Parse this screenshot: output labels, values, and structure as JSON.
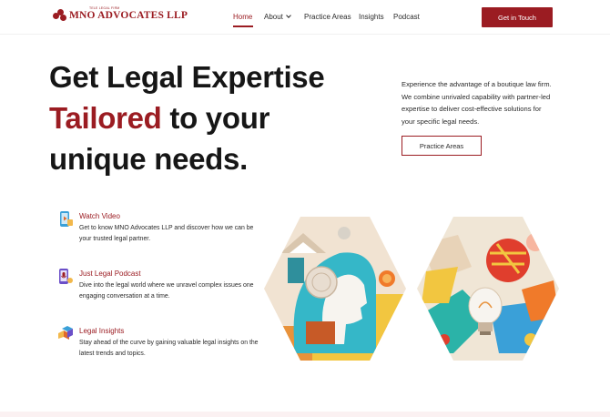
{
  "header": {
    "logo_tagline": "TELE LEGAL FIRM",
    "logo_name": "MNO ADVOCATES LLP",
    "nav": [
      {
        "label": "Home"
      },
      {
        "label": "About"
      },
      {
        "label": "Practice Areas"
      },
      {
        "label": "Insights"
      },
      {
        "label": "Podcast"
      }
    ],
    "cta_label": "Get in Touch"
  },
  "hero": {
    "title_line1": "Get Legal Expertise",
    "title_accent": "Tailored",
    "title_line2_rest": " to your",
    "title_line3": "unique needs.",
    "description": "Experience the advantage of a boutique law firm. We combine unrivaled capability with partner-led expertise to deliver cost-effective solutions for your specific legal needs.",
    "button_label": "Practice Areas"
  },
  "features": [
    {
      "title": "Watch Video",
      "text": "Get to know MNO Advocates LLP and discover how we can be your trusted legal partner.",
      "icon": "video-icon"
    },
    {
      "title": "Just Legal Podcast",
      "text": "Dive into the legal world where we unravel complex issues one engaging conversation at a time.",
      "icon": "podcast-icon"
    },
    {
      "title": "Legal Insights",
      "text": "Stay ahead of the curve by gaining valuable legal insights on the latest trends and topics.",
      "icon": "insights-icon"
    }
  ],
  "colors": {
    "brand": "#9b1c22",
    "text": "#161616"
  }
}
